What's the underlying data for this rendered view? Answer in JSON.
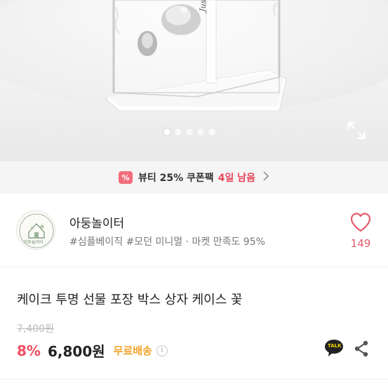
{
  "hero": {
    "image_alt": "Transparent cake gift box",
    "box_ribbon_text": "Just for you",
    "page_indicator": {
      "total": 5,
      "active": 1
    },
    "expand_icon": "fullscreen-expand-icon"
  },
  "coupon": {
    "badge": "%",
    "label": "뷰티 25% 쿠폰팩",
    "deadline": "4일 남음",
    "icon": "chevron-right-icon"
  },
  "seller": {
    "avatar_text": "아둥놀이터",
    "name": "아둥놀이터",
    "tags": "#심플베이직 #모던 미니멀 · 마켓 만족도 95%",
    "like_icon": "heart-outline-icon",
    "like_count": "149"
  },
  "product": {
    "title": "케이크 투명 선물 포장 박스 상자 케이스 꽃",
    "original_price": "7,400원",
    "discount": "8%",
    "price": "6,800원",
    "shipping": "무료배송",
    "info_icon": "info-icon",
    "talk_icon": "kakao-talk-icon",
    "talk_label": "TALK",
    "share_icon": "share-icon"
  },
  "colors": {
    "accent_red": "#ee4e62",
    "shipping_orange": "#f0a42b",
    "heart_pink": "#e35a6b"
  }
}
